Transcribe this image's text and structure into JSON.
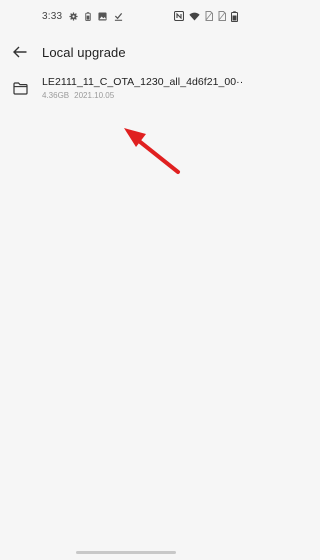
{
  "status_bar": {
    "time": "3:33",
    "left_icons": [
      "gear-icon",
      "battery-saver-icon",
      "image-icon",
      "download-done-icon"
    ],
    "right_icons": [
      "nfc-icon",
      "wifi-icon",
      "sim1-icon",
      "sim2-icon",
      "battery-icon"
    ]
  },
  "app_bar": {
    "back_icon": "arrow-left-icon",
    "title": "Local upgrade"
  },
  "files": [
    {
      "name": "LE2111_11_C_OTA_1230_all_4d6f21_00··",
      "size": "4.36GB",
      "date": "2021.10.05",
      "icon": "folder-icon"
    }
  ],
  "annotation": {
    "type": "arrow",
    "color": "#e02020"
  }
}
